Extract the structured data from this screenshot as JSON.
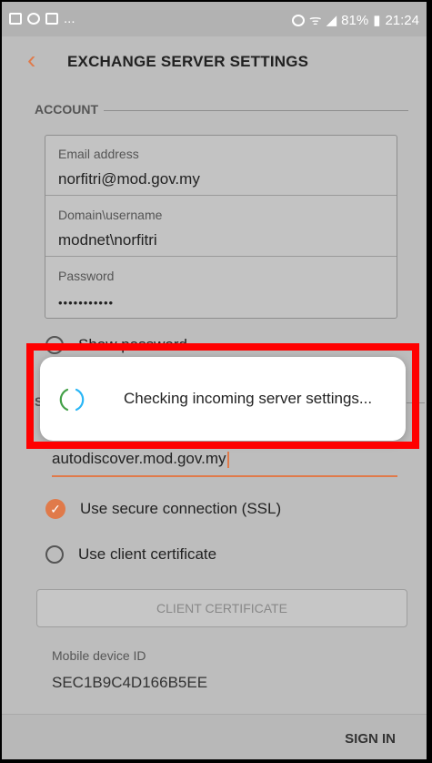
{
  "status_bar": {
    "battery": "81%",
    "time": "21:24",
    "notification_more": "..."
  },
  "header": {
    "title": "EXCHANGE SERVER SETTINGS"
  },
  "account_section": {
    "label": "ACCOUNT"
  },
  "credentials": {
    "email_label": "Email address",
    "email_value": "norfitri@mod.gov.my",
    "domain_label": "Domain\\username",
    "domain_value": "modnet\\norfitri",
    "password_label": "Password",
    "password_value": "•••••••••••"
  },
  "show_password_label": "Show password",
  "server_section": {
    "label_visible": "S"
  },
  "server": {
    "value": "autodiscover.mod.gov.my"
  },
  "ssl": {
    "label": "Use secure connection (SSL)",
    "checked": true
  },
  "client_certificate": {
    "label": "Use client certificate",
    "checked": false
  },
  "client_cert_button": {
    "label": "CLIENT CERTIFICATE"
  },
  "mobile_device": {
    "label": "Mobile device ID",
    "value": "SEC1B9C4D166B5EE"
  },
  "bottom": {
    "sign_in_label": "SIGN IN"
  },
  "dialog": {
    "message": "Checking incoming server settings..."
  },
  "colors": {
    "accent": "#e07a4a",
    "highlight": "#ff0000",
    "spinner_green": "#43a047",
    "spinner_blue": "#29b6f6"
  }
}
